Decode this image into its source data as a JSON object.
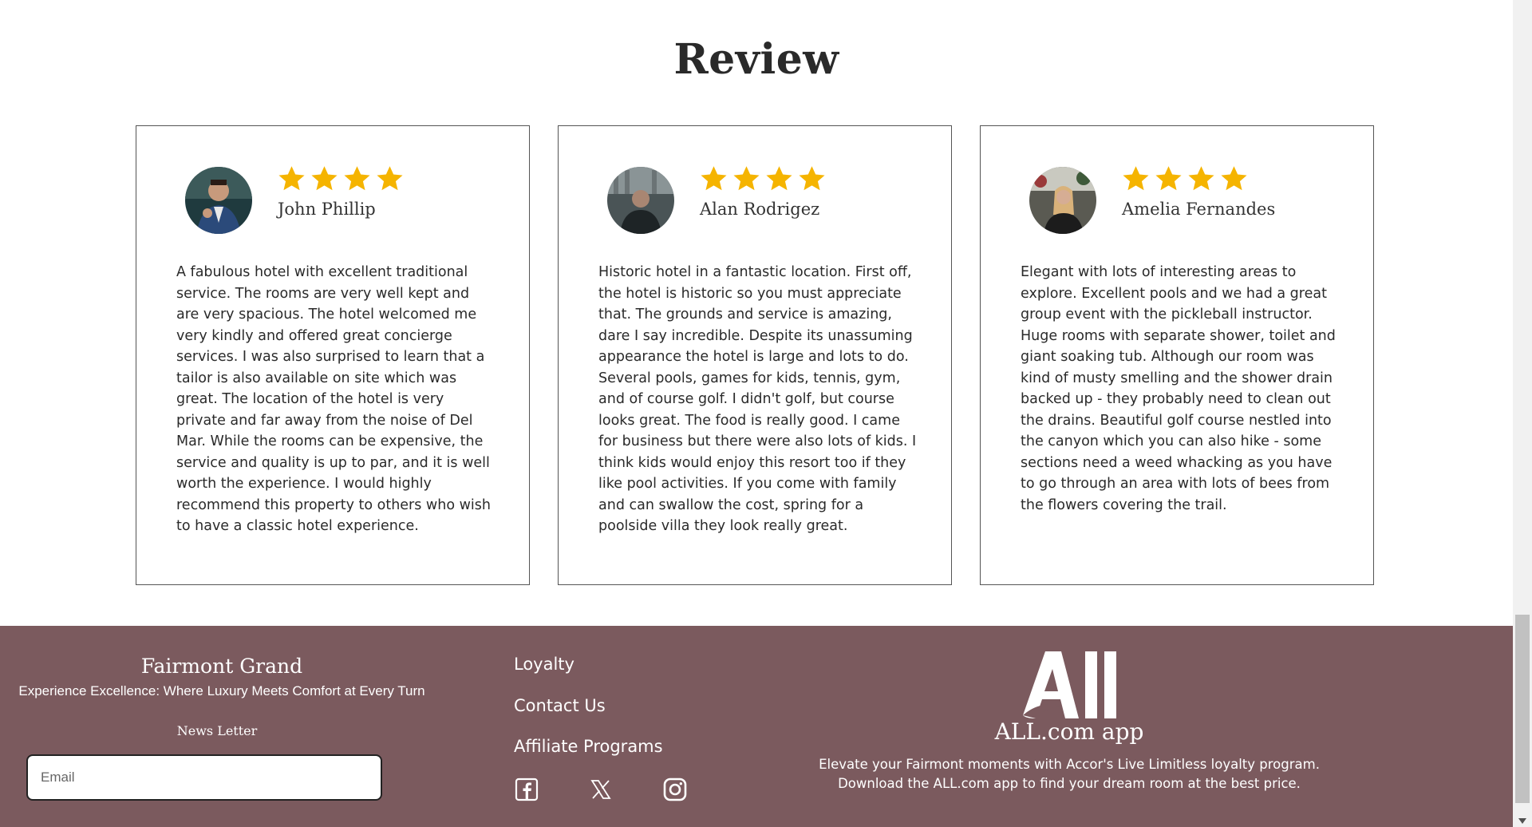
{
  "review": {
    "title": "Review",
    "cards": [
      {
        "name": "John Phillip",
        "rating": 4,
        "text": "A fabulous hotel with excellent traditional service. The rooms are very well kept and are very spacious. The hotel welcomed me very kindly and offered great concierge services. I was also surprised to learn that a tailor is also available on site which was great. The location of the hotel is very private and far away from the noise of Del Mar. While the rooms can be expensive, the service and quality is up to par, and it is well worth the experience. I would highly recommend this property to others who wish to have a classic hotel experience."
      },
      {
        "name": "Alan Rodrigez",
        "rating": 4,
        "text": "Historic hotel in a fantastic location. First off, the hotel is historic so you must appreciate that. The grounds and service is amazing, dare I say incredible. Despite its unassuming appearance the hotel is large and lots to do. Several pools, games for kids, tennis, gym, and of course golf. I didn't golf, but course looks great. The food is really good. I came for business but there were also lots of kids. I think kids would enjoy this resort too if they like pool activities. If you come with family and can swallow the cost, spring for a poolside villa they look really great."
      },
      {
        "name": "Amelia Fernandes",
        "rating": 4,
        "text": "Elegant with lots of interesting areas to explore. Excellent pools and we had a great group event with the pickleball instructor. Huge rooms with separate shower, toilet and giant soaking tub. Although our room was kind of musty smelling and the shower drain backed up - they probably need to clean out the drains. Beautiful golf course nestled into the canyon which you can also hike - some sections need a weed whacking as you have to go through an area with lots of bees from the flowers covering the trail."
      }
    ]
  },
  "footer": {
    "brand_name": "Fairmont Grand",
    "tagline": "Experience Excellence: Where Luxury Meets Comfort at Every Turn",
    "newsletter_label": "News Letter",
    "email_placeholder": "Email",
    "links": {
      "loyalty": "Loyalty",
      "contact": "Contact Us",
      "affiliate": "Affiliate Programs"
    },
    "social_icons": [
      "facebook-icon",
      "x-twitter-icon",
      "instagram-icon"
    ],
    "app_logo_text": "All",
    "app_title": "ALL.com app",
    "app_desc_line1": "Elevate your Fairmont moments with Accor's Live Limitless loyalty program.",
    "app_desc_line2": "Download the ALL.com app to find your dream room at the best price."
  },
  "colors": {
    "footer_bg": "#7b5a5e",
    "star": "#f5b400",
    "card_border": "#555555"
  }
}
